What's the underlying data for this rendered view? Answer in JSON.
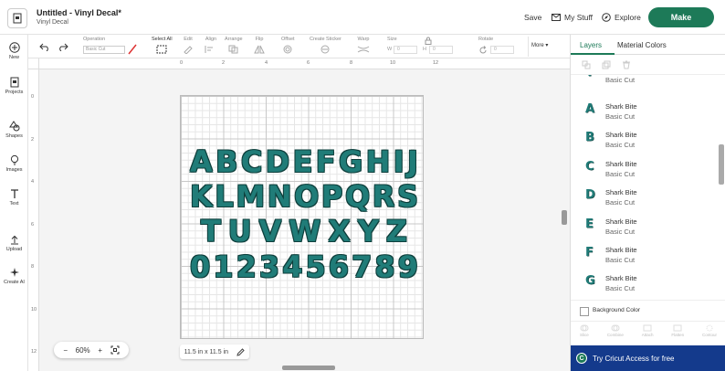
{
  "header": {
    "doc_title": "Untitled - Vinyl Decal*",
    "doc_subtitle": "Vinyl Decal",
    "save": "Save",
    "my_stuff": "My Stuff",
    "explore": "Explore",
    "make": "Make"
  },
  "rail": {
    "items": [
      {
        "label": "New",
        "icon": "plus-circle-icon"
      },
      {
        "label": "Projects",
        "icon": "projects-icon"
      },
      {
        "label": "Shapes",
        "icon": "shapes-icon"
      },
      {
        "label": "Images",
        "icon": "lightbulb-icon"
      },
      {
        "label": "Text",
        "icon": "text-icon"
      },
      {
        "label": "Upload",
        "icon": "upload-icon"
      },
      {
        "label": "Create AI",
        "icon": "sparkle-icon"
      }
    ]
  },
  "toolbar": {
    "operation_label": "Operation",
    "operation_value": "Basic Cut",
    "select_all": "Select All",
    "edit": "Edit",
    "align": "Align",
    "arrange": "Arrange",
    "flip": "Flip",
    "offset": "Offset",
    "create_sticker": "Create Sticker",
    "warp": "Warp",
    "size": "Size",
    "width_label": "W",
    "height_label": "H",
    "width_value": "0",
    "height_value": "0",
    "rotate": "Rotate",
    "rotate_value": "0",
    "more": "More"
  },
  "canvas": {
    "ruler_top": [
      "0",
      "2",
      "4",
      "6",
      "8",
      "10",
      "12"
    ],
    "ruler_left": [
      "0",
      "2",
      "4",
      "6",
      "8",
      "10",
      "12"
    ],
    "letters": [
      [
        "A",
        "B",
        "C",
        "D",
        "E",
        "F",
        "G",
        "H",
        "I",
        "J"
      ],
      [
        "K",
        "L",
        "M",
        "N",
        "O",
        "P",
        "Q",
        "R",
        "S"
      ],
      [
        "T",
        "U",
        "V",
        "W",
        "X",
        "Y",
        "Z"
      ],
      [
        "0",
        "1",
        "2",
        "3",
        "4",
        "5",
        "6",
        "7",
        "8",
        "9"
      ]
    ],
    "zoom": "60%",
    "zoom_minus": "−",
    "zoom_plus": "+",
    "size_readout": "11.5 in x 11.5 in"
  },
  "panel": {
    "tab_layers": "Layers",
    "tab_colors": "Material Colors",
    "layers": [
      {
        "glyph": "Y",
        "name": "",
        "op": "Basic Cut"
      },
      {
        "glyph": "A",
        "name": "Shark Bite",
        "op": "Basic Cut"
      },
      {
        "glyph": "B",
        "name": "Shark Bite",
        "op": "Basic Cut"
      },
      {
        "glyph": "C",
        "name": "Shark Bite",
        "op": "Basic Cut"
      },
      {
        "glyph": "D",
        "name": "Shark Bite",
        "op": "Basic Cut"
      },
      {
        "glyph": "E",
        "name": "Shark Bite",
        "op": "Basic Cut"
      },
      {
        "glyph": "F",
        "name": "Shark Bite",
        "op": "Basic Cut"
      },
      {
        "glyph": "G",
        "name": "Shark Bite",
        "op": "Basic Cut"
      }
    ],
    "background_color": "Background Color",
    "bottom_actions": [
      "Slice",
      "Combine",
      "Attach",
      "Flatten",
      "Contour"
    ],
    "banner": "Try Cricut Access for free",
    "banner_logo": "C"
  },
  "colors": {
    "accent": "#1d7a58",
    "glyph": "#207c78",
    "banner": "#143a8c"
  }
}
